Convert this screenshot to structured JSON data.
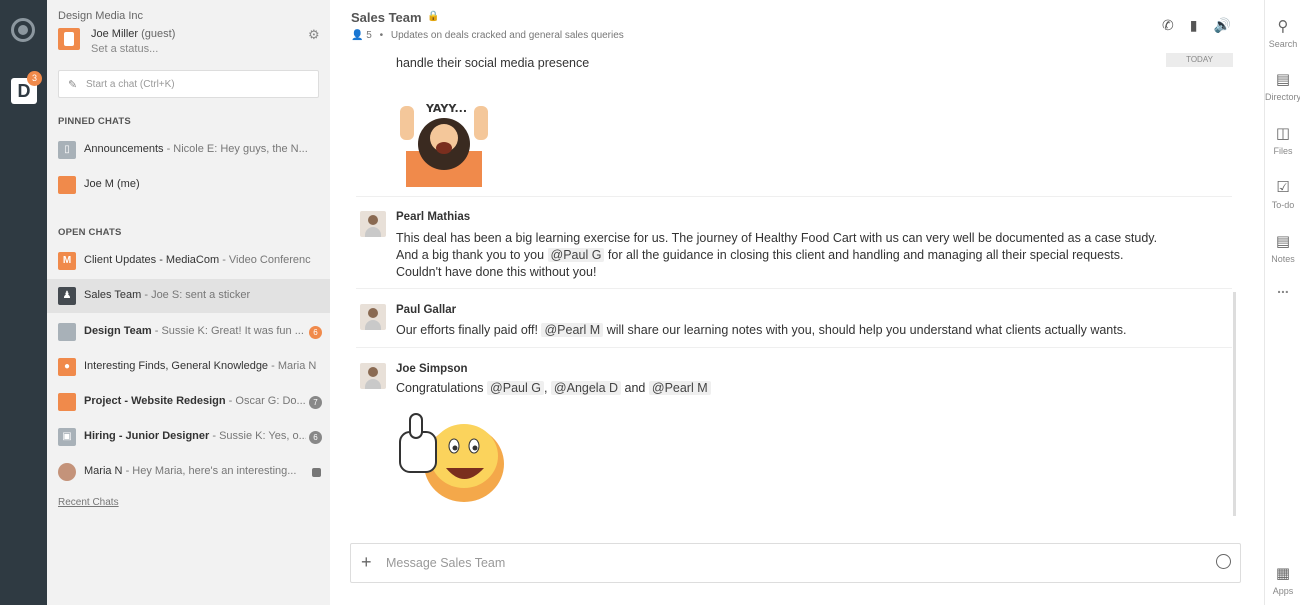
{
  "rail": {
    "workspace_letter": "D",
    "workspace_badge": "3"
  },
  "sidebar": {
    "org": "Design Media Inc",
    "user_name": "Joe Miller",
    "user_role": "(guest)",
    "status_placeholder": "Set a status...",
    "search_placeholder": "Start a chat (Ctrl+K)",
    "pinned_label": "PINNED CHATS",
    "open_label": "OPEN CHATS",
    "recent_link": "Recent Chats",
    "pinned": [
      {
        "name": "Announcements",
        "preview": "- Nicole E: Hey guys, the N...",
        "color": "#a8b1b8"
      },
      {
        "name": "Joe M (me)",
        "preview": "",
        "color": "#f08a4b"
      }
    ],
    "open": [
      {
        "name": "Client Updates - MediaCom",
        "preview": "- Video Conferenc",
        "color": "#f08a4b",
        "letter": "M",
        "bold": false,
        "count": ""
      },
      {
        "name": "Sales Team",
        "preview": "- Joe S: sent a sticker",
        "color": "#444a50",
        "letter": "",
        "bold": false,
        "count": ""
      },
      {
        "name": "Design Team",
        "preview": "- Sussie K: Great! It was fun ...",
        "color": "#a8b1b8",
        "letter": "",
        "bold": true,
        "count": "6"
      },
      {
        "name": "Interesting Finds, General Knowledge",
        "preview": "- Maria N",
        "color": "#f08a4b",
        "letter": "",
        "bold": false,
        "count": ""
      },
      {
        "name": "Project - Website Redesign",
        "preview": "- Oscar G: Do...",
        "color": "#f08a4b",
        "letter": "",
        "bold": true,
        "count": "7"
      },
      {
        "name": "Hiring - Junior Designer",
        "preview": "- Sussie K: Yes, o...",
        "color": "#a8b1b8",
        "letter": "",
        "bold": true,
        "count": "6"
      },
      {
        "name": "Maria N",
        "preview": "- Hey Maria, here's an interesting...",
        "color": "#c4937a",
        "letter": "",
        "bold": false,
        "count": ""
      }
    ]
  },
  "channel": {
    "title": "Sales Team",
    "members": "5",
    "description": "Updates on deals cracked and general sales queries",
    "today": "TODAY"
  },
  "messages": {
    "top_line": "handle their social media presence",
    "sticker1_text": "YAYY...",
    "pearl_name": "Pearl Mathias",
    "pearl_line1": "This deal has been a big learning exercise for us. The journey of Healthy Food Cart with us can very well be documented as a case study.",
    "pearl_line2_a": "And a big thank you to you",
    "pearl_mention": "@Paul G",
    "pearl_line2_b": "for all the guidance in closing this client and handling and managing all their special requests.",
    "pearl_line3": "Couldn't have done this without you!",
    "paul_name": "Paul Gallar",
    "paul_a": "Our efforts finally paid off!",
    "paul_mention": "@Pearl M",
    "paul_b": "will share our learning notes with you, should help you understand what clients actually wants.",
    "joe_name": "Joe Simpson",
    "joe_a": "Congratulations",
    "joe_m1": "@Paul G",
    "joe_comma": ",",
    "joe_m2": "@Angela D",
    "joe_and": "and",
    "joe_m3": "@Pearl M"
  },
  "composer": {
    "placeholder": "Message Sales Team"
  },
  "right_rail": {
    "search": "Search",
    "directory": "Directory",
    "files": "Files",
    "todo": "To-do",
    "notes": "Notes",
    "more": "...",
    "apps": "Apps"
  }
}
